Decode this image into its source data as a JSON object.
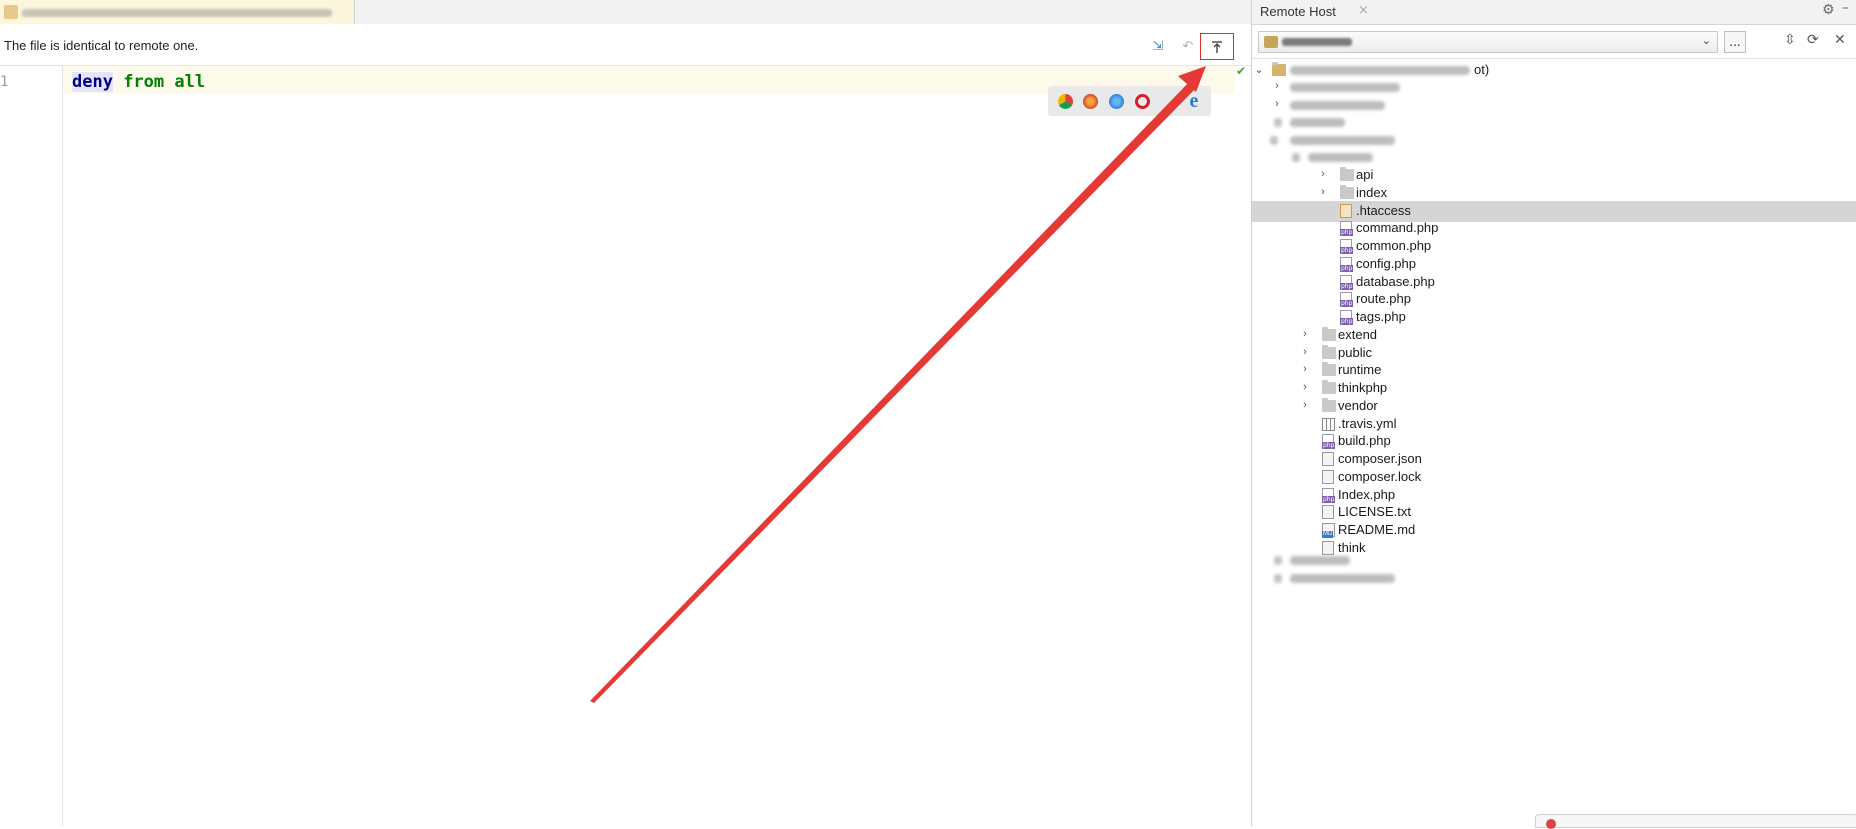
{
  "editor": {
    "tab_title": "",
    "status_text": "The file is identical to remote one.",
    "toolbar": {
      "compare_icon": "compare-arrows-icon",
      "revert_icon": "revert-icon",
      "upload_icon": "upload-to-remote-icon"
    },
    "line_number": "1",
    "code": {
      "keyword": "deny",
      "rest": " from all"
    },
    "browsers": [
      "chrome-icon",
      "firefox-icon",
      "safari-icon",
      "opera-icon",
      "edge-icon"
    ],
    "edge_glyph": "e",
    "check_glyph": "✔"
  },
  "remote_host": {
    "title": "Remote Host",
    "close_glyph": "×",
    "browse_label": "...",
    "tree": [
      {
        "label": "api",
        "type": "folder",
        "indent": 4,
        "chevron": "›"
      },
      {
        "label": "index",
        "type": "folder",
        "indent": 4,
        "chevron": "›"
      },
      {
        "label": ".htaccess",
        "type": "htaccess",
        "indent": 4,
        "selected": true
      },
      {
        "label": "command.php",
        "type": "php",
        "indent": 4
      },
      {
        "label": "common.php",
        "type": "php",
        "indent": 4
      },
      {
        "label": "config.php",
        "type": "php",
        "indent": 4
      },
      {
        "label": "database.php",
        "type": "php",
        "indent": 4
      },
      {
        "label": "route.php",
        "type": "php",
        "indent": 4
      },
      {
        "label": "tags.php",
        "type": "php",
        "indent": 4
      },
      {
        "label": "extend",
        "type": "folder",
        "indent": 3,
        "chevron": "›"
      },
      {
        "label": "public",
        "type": "folder",
        "indent": 3,
        "chevron": "›"
      },
      {
        "label": "runtime",
        "type": "folder",
        "indent": 3,
        "chevron": "›"
      },
      {
        "label": "thinkphp",
        "type": "folder",
        "indent": 3,
        "chevron": "›"
      },
      {
        "label": "vendor",
        "type": "folder",
        "indent": 3,
        "chevron": "›"
      },
      {
        "label": ".travis.yml",
        "type": "grid",
        "indent": 3
      },
      {
        "label": "build.php",
        "type": "php",
        "indent": 3
      },
      {
        "label": "composer.json",
        "type": "gen",
        "indent": 3
      },
      {
        "label": "composer.lock",
        "type": "gen",
        "indent": 3
      },
      {
        "label": "Index.php",
        "type": "php",
        "indent": 3
      },
      {
        "label": "LICENSE.txt",
        "type": "gen",
        "indent": 3
      },
      {
        "label": "README.md",
        "type": "md",
        "indent": 3
      },
      {
        "label": "think",
        "type": "gen",
        "indent": 3
      }
    ],
    "root_suffix": "ot)"
  },
  "colors": {
    "annotation_arrow": "#e53935",
    "selection": "#d5d5d5"
  }
}
